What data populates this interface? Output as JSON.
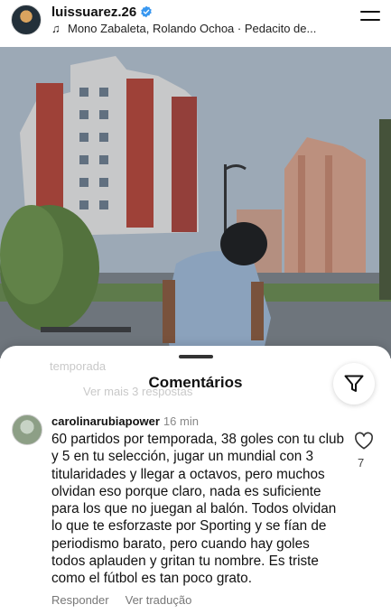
{
  "header": {
    "username": "luissuarez.26",
    "music": "Mono Zabaleta, Rolando Ochoa · Pedacito de..."
  },
  "sheet": {
    "title": "Comentários",
    "ghost_text_1": "temporada",
    "ghost_text_2": "Ver mais 3 respostas"
  },
  "comment": {
    "username": "carolinarubiapower",
    "time": "16 min",
    "text": "60 partidos por temporada, 38 goles con tu club y 5 en tu selección, jugar un mundial con 3 titularidades y llegar a octavos, pero muchos olvidan eso porque claro, nada es suficiente para los que no juegan al balón. Todos olvidan lo que te esforzaste por Sporting y se fían de periodismo barato, pero cuando hay goles todos aplauden y gritan tu nombre. Es triste como el fútbol es tan poco grato.",
    "likes": "7",
    "reply_label": "Responder",
    "translate_label": "Ver tradução"
  },
  "icons": {
    "verified": "verified-badge-icon",
    "music": "music-note-icon",
    "menu": "menu-icon",
    "filter": "filter-icon",
    "like": "heart-icon"
  },
  "colors": {
    "verified_blue": "#3897f0"
  }
}
